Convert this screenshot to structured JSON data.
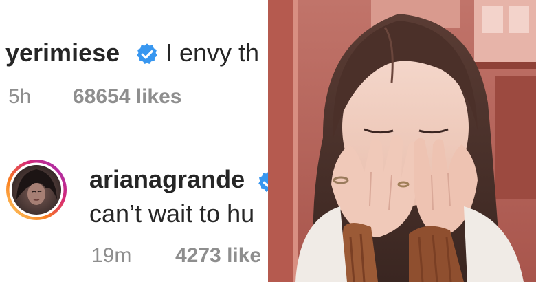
{
  "comment_1": {
    "username": "yerimiese",
    "text": "I envy th",
    "time": "5h",
    "likes": "68654 likes",
    "verified_icon": "verified-badge-icon"
  },
  "comment_2": {
    "username": "arianagrande",
    "text": "can’t wait to hu",
    "time": "19m",
    "likes": "4273 like",
    "verified_icon": "verified-badge-icon",
    "avatar_icon": "profile-avatar"
  },
  "colors": {
    "username": "#262626",
    "meta": "#8e8e8e",
    "verified": "#3897f0",
    "story_ring": [
      "#feda75",
      "#fa7e1e",
      "#d62976",
      "#962fbf"
    ]
  }
}
